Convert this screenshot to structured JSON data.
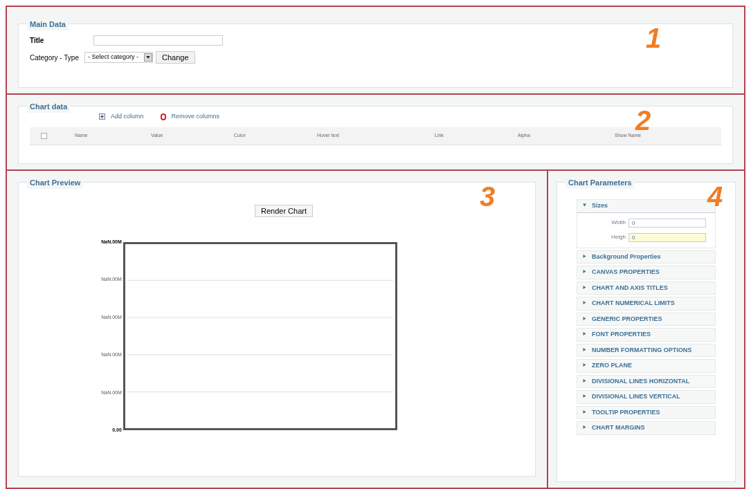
{
  "main_data": {
    "legend": "Main Data",
    "marker": "1",
    "title_label": "Title",
    "category_label": "Category - Type",
    "category_select": "- Select category -",
    "change_button": "Change"
  },
  "chart_data_section": {
    "legend": "Chart data",
    "marker": "2",
    "add_column": "Add column",
    "remove_columns": "Remove columns",
    "select_all_checked": false,
    "columns": [
      "Name",
      "Value",
      "Color",
      "Hover text",
      "Link",
      "Alpha",
      "Show Name"
    ]
  },
  "chart_preview": {
    "legend": "Chart Preview",
    "marker": "3",
    "render_button": "Render Chart",
    "y_labels": [
      "NaN.00M",
      "NaN.00M",
      "NaN.00M",
      "NaN.00M",
      "NaN.00M",
      "0.00"
    ]
  },
  "chart_parameters": {
    "legend": "Chart Parameters",
    "marker": "4",
    "groups": [
      {
        "label": "Sizes",
        "expanded": true,
        "fields": [
          {
            "label": "Width",
            "value": "0",
            "focused": false
          },
          {
            "label": "Heigh",
            "value": "0",
            "focused": true
          }
        ]
      },
      {
        "label": "Background Properties",
        "expanded": false
      },
      {
        "label": "CANVAS PROPERTIES",
        "expanded": false
      },
      {
        "label": "CHART AND AXIS TITLES",
        "expanded": false
      },
      {
        "label": "CHART NUMERICAL LIMITS",
        "expanded": false
      },
      {
        "label": "GENERIC PROPERTIES",
        "expanded": false
      },
      {
        "label": "FONT PROPERTIES",
        "expanded": false
      },
      {
        "label": "NUMBER FORMATTING OPTIONS",
        "expanded": false
      },
      {
        "label": "ZERO PLANE",
        "expanded": false
      },
      {
        "label": "DIVISIONAL LINES HORIZONTAL",
        "expanded": false
      },
      {
        "label": "DIVISIONAL LINES VERTICAL",
        "expanded": false
      },
      {
        "label": "TOOLTIP PROPERTIES",
        "expanded": false
      },
      {
        "label": "CHART MARGINS",
        "expanded": false
      }
    ]
  }
}
